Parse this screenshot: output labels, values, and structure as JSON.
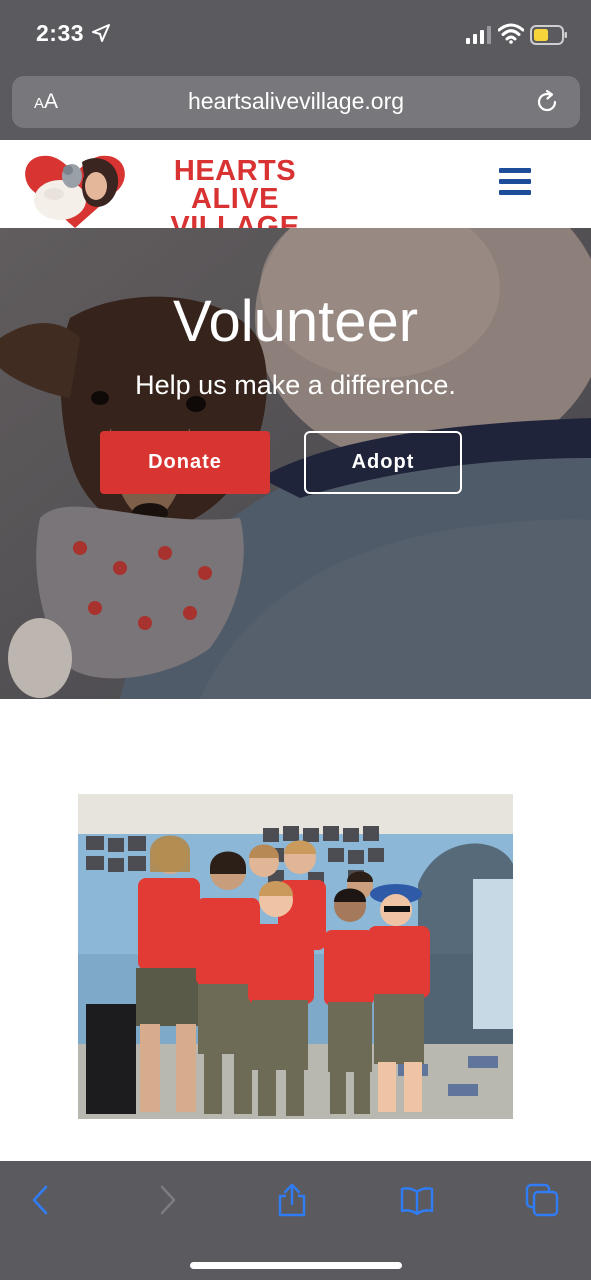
{
  "status_bar": {
    "time": "2:33",
    "icons": [
      "location-arrow-icon",
      "signal-icon",
      "wifi-icon",
      "battery-icon"
    ]
  },
  "browser": {
    "aa_label_small": "A",
    "aa_label_large": "A",
    "url": "heartsalivevillage.org",
    "reload_icon": "reload-icon"
  },
  "site": {
    "logo_line1": "HEARTS ALIVE",
    "logo_line2": "VILLAGE",
    "menu_icon": "hamburger-menu-icon",
    "brand_red": "#d83432",
    "brand_blue": "#1d4c9b"
  },
  "hero": {
    "title": "Volunteer",
    "subtitle": "Help us make a difference.",
    "donate_label": "Donate",
    "adopt_label": "Adopt"
  },
  "toolbar": {
    "icons": [
      "back-icon",
      "forward-icon",
      "share-icon",
      "bookmarks-icon",
      "tabs-icon"
    ],
    "accent": "#2f7cf6"
  }
}
